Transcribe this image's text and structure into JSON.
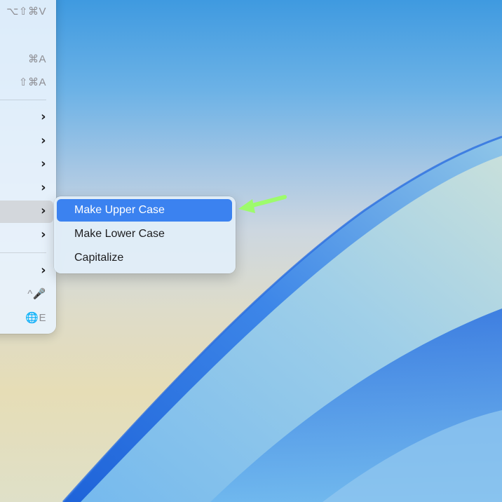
{
  "main_menu": {
    "shortcuts": {
      "paste_match_style": "⌥⇧⌘V",
      "select_all": "⌘A",
      "deselect_all": "⇧⌘A",
      "dictation": "^🎤",
      "emoji": "🌐E"
    },
    "submenu_chevron": "›"
  },
  "submenu": {
    "items": [
      {
        "label": "Make Upper Case",
        "selected": true
      },
      {
        "label": "Make Lower Case",
        "selected": false
      },
      {
        "label": "Capitalize",
        "selected": false
      }
    ]
  },
  "colors": {
    "selection_blue": "#3b82f0",
    "annotation_arrow": "#9dfb6c"
  }
}
